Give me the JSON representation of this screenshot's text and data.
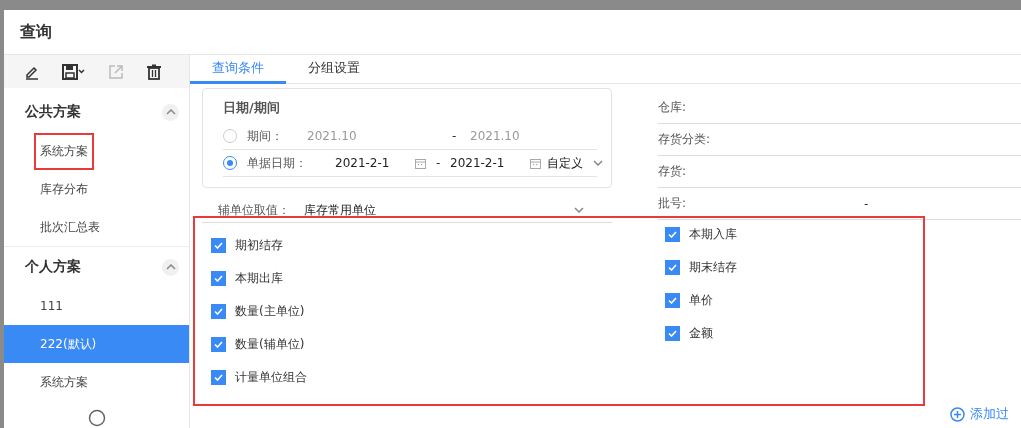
{
  "window": {
    "title": "查询"
  },
  "toolbar": [
    {
      "kind": "edit",
      "disabled": false
    },
    {
      "kind": "save",
      "disabled": false
    },
    {
      "kind": "export",
      "disabled": true
    },
    {
      "kind": "delete",
      "disabled": false
    }
  ],
  "sidebar": {
    "groups": [
      {
        "title": "公共方案",
        "expanded": true,
        "items": [
          {
            "label": "系统方案",
            "selected": false,
            "highlighted": true
          },
          {
            "label": "库存分布",
            "selected": false,
            "highlighted": false
          },
          {
            "label": "批次汇总表",
            "selected": false,
            "highlighted": false
          }
        ]
      },
      {
        "title": "个人方案",
        "expanded": true,
        "items": [
          {
            "label": "111",
            "selected": false,
            "highlighted": false
          },
          {
            "label": "222(默认)",
            "selected": true,
            "highlighted": false
          },
          {
            "label": "系统方案",
            "selected": false,
            "highlighted": false
          }
        ]
      }
    ]
  },
  "tabs": [
    {
      "label": "查询条件",
      "selected": true
    },
    {
      "label": "分组设置",
      "selected": false
    }
  ],
  "date_section": {
    "title": "日期/期间",
    "options": [
      {
        "kind": "period",
        "label": "期间：",
        "selected": false,
        "from": "2021.10",
        "separator": "-",
        "to": "2021.10"
      },
      {
        "kind": "date",
        "label": "单据日期：",
        "selected": true,
        "from": "2021-2-1",
        "separator": "-",
        "to": "2021-2-1",
        "range": "自定义"
      }
    ]
  },
  "aux_unit": {
    "label": "辅单位取值：",
    "value": "库存常用单位"
  },
  "filters": [
    {
      "label": "仓库:"
    },
    {
      "label": "存货分类:"
    },
    {
      "label": "存货:"
    },
    {
      "label": "批号:",
      "separator": "-"
    }
  ],
  "checks": {
    "highlighted": true,
    "left": [
      {
        "label": "期初结存",
        "checked": true
      },
      {
        "label": "本期出库",
        "checked": true
      },
      {
        "label": "数量(主单位)",
        "checked": true
      },
      {
        "label": "数量(辅单位)",
        "checked": true
      },
      {
        "label": "计量单位组合",
        "checked": true
      }
    ],
    "right": [
      {
        "label": "本期入库",
        "checked": true
      },
      {
        "label": "期末结存",
        "checked": true
      },
      {
        "label": "单价",
        "checked": true
      },
      {
        "label": "金额",
        "checked": true
      }
    ]
  },
  "add_filter": {
    "label": "添加过"
  }
}
